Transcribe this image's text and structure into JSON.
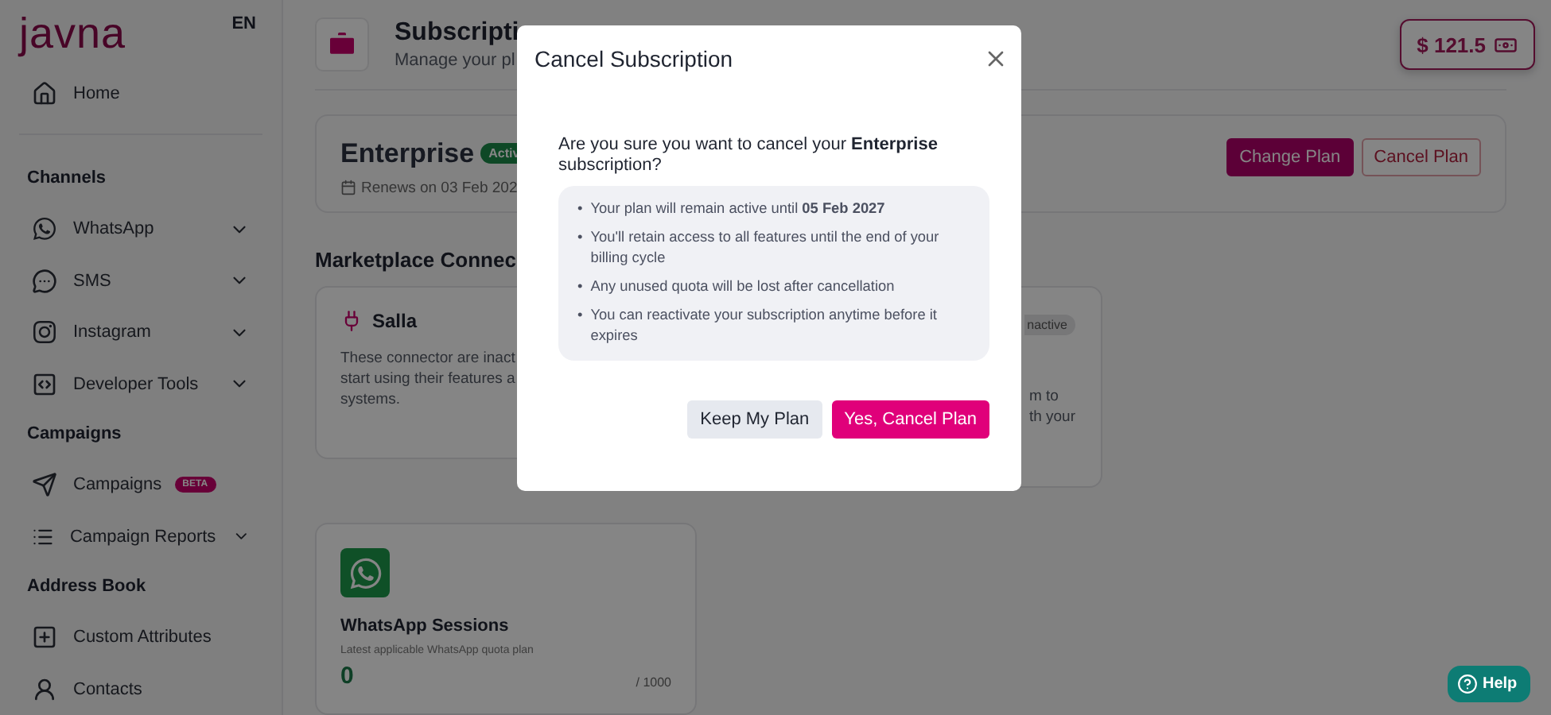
{
  "sidebar": {
    "logo": "javna",
    "language": "EN",
    "home": {
      "label": "Home"
    },
    "sections": [
      {
        "heading": "Channels",
        "items": [
          {
            "label": "WhatsApp",
            "has_submenu": true
          },
          {
            "label": "SMS",
            "has_submenu": true
          },
          {
            "label": "Instagram",
            "has_submenu": true
          },
          {
            "label": "Developer Tools",
            "has_submenu": true
          }
        ]
      },
      {
        "heading": "Campaigns",
        "items": [
          {
            "label": "Campaigns",
            "badge": "BETA",
            "has_submenu": false
          },
          {
            "label": "Campaign Reports",
            "has_submenu": true
          }
        ]
      },
      {
        "heading": "Address Book",
        "items": [
          {
            "label": "Custom Attributes",
            "has_submenu": false
          },
          {
            "label": "Contacts",
            "has_submenu": false
          }
        ]
      }
    ]
  },
  "header": {
    "title": "Subscripti",
    "subtitle": "Manage your pl",
    "balance": "$ 121.5"
  },
  "plan": {
    "name": "Enterprise",
    "status": "Activ",
    "renewal": "Renews on 03 Feb 202",
    "buttons": [
      {
        "label": "Change Plan",
        "kind": "primary"
      },
      {
        "label": "Cancel Plan",
        "kind": "outline"
      }
    ]
  },
  "marketplace": {
    "heading": "Marketplace Connec",
    "cards": [
      {
        "kind": "full",
        "name": "Salla",
        "lines": [
          "These connector are inact",
          "start using their features a",
          "systems."
        ]
      },
      {
        "kind": "covered",
        "status": "nactive",
        "lines": [
          "m to",
          "th your"
        ]
      }
    ]
  },
  "sessions": {
    "title": "WhatsApp Sessions",
    "caption": "Latest applicable WhatsApp quota plan",
    "used": "0",
    "total": "/ 1000"
  },
  "help": "Help",
  "dialog": {
    "title": "Cancel Subscription",
    "question": "Are you sure you want to cancel your **Enterprise** subscription?",
    "marker": "•",
    "notes": [
      "Your plan will remain active until **05 Feb 2027**",
      "You'll retain access to all features until the end of your billing cycle",
      "Any unused quota will be lost after cancellation",
      "You can reactivate your subscription anytime before it expires"
    ],
    "buttons": [
      {
        "label": "Keep My Plan",
        "kind": "secondary"
      },
      {
        "label": "Yes, Cancel Plan",
        "kind": "primary"
      }
    ]
  }
}
